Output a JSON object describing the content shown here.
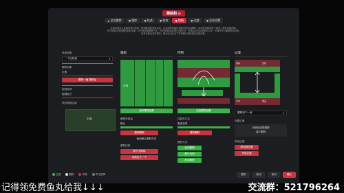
{
  "dialog": {
    "title": "跟踪和 ◎",
    "tabs": [
      {
        "icon": "star-icon",
        "label": "全局跟踪"
      },
      {
        "icon": "heart-icon",
        "label": "跟踪"
      },
      {
        "icon": "heart-icon",
        "label": "轨迹"
      },
      {
        "icon": "heart-icon",
        "label": "结构"
      },
      {
        "icon": "heart-icon",
        "label": "控制"
      },
      {
        "icon": "heart-icon",
        "label": "过渡"
      },
      {
        "icon": "heart-icon",
        "label": "全局设置"
      }
    ],
    "active_tab_index": 4,
    "description": [
      "此窗口用来从选择列表中找到一组想要追踪的目标点。这会帮助创建在视频中的运动跟踪，请将鼠标移到各个选项上查看详细说明。",
      "在左侧选中你想要控制的对象，在中间设置跟踪方式，在右侧选择运动的过渡方式。完成后点击应用即可生效，不满意可以撤销重新设置。",
      "所有设置会实时预览，确认后请点击下方的确认按钮保存全部设置。"
    ]
  },
  "sidebar": {
    "section_label": "选择对象",
    "select_value": "一个目标组",
    "tracking_label": "跟踪对象",
    "tracking_value": "正常",
    "track_button": "跟踪一遍 跟踪全",
    "control_label": "控制选项",
    "control_value": "控制自己",
    "preview_label": "预览视频区域",
    "preview_text": "平铺"
  },
  "columns": {
    "tracking": {
      "header": "跟踪",
      "block_label": "正常",
      "btn1": "保存跟踪结果",
      "sub_label1": "跟踪的数量",
      "sub_value1": "默认",
      "btn2": "撤销跟踪",
      "btn3": "使用默认跟踪方式",
      "sub_label2": "跟踪控制",
      "btn4": "基于当前帧",
      "btn5": "切换至下一个"
    },
    "control": {
      "header": "控制",
      "btn1": "应用跟踪结果",
      "sub_label1": "控制的方法",
      "sub_value1": "更多选项",
      "btn2": "替换跟踪",
      "sub_label2": "跟踪方式",
      "btn3a": "反向跟踪",
      "btn3b": "基于当前",
      "btn4": "反向跟踪"
    },
    "transition": {
      "header": "过渡",
      "labels": [
        "跟踪",
        "更新",
        "反向",
        "覆盖"
      ],
      "dropdown": "跟踪到下一帧",
      "sub_label": "设置过渡",
      "btn1": "切换到选择跟踪",
      "btn2": "减少跟踪",
      "sub_label2": "其他过渡",
      "btn3": "移动到过渡",
      "btn4": "完成过渡"
    }
  },
  "legend": [
    {
      "label": "已选",
      "color": "#3db34a"
    },
    {
      "label": "跟踪",
      "color": "#dddddd"
    },
    {
      "label": "冲突",
      "color": "#c73542"
    },
    {
      "label": "不可选择",
      "color": "#777777"
    }
  ],
  "footer": {
    "buttons": [
      "跟踪",
      "取消",
      "取消",
      "确认"
    ]
  },
  "overlay": {
    "left_text": "记得领免费鱼丸给我↓↓↓",
    "right_text": "交流群：521796264"
  }
}
